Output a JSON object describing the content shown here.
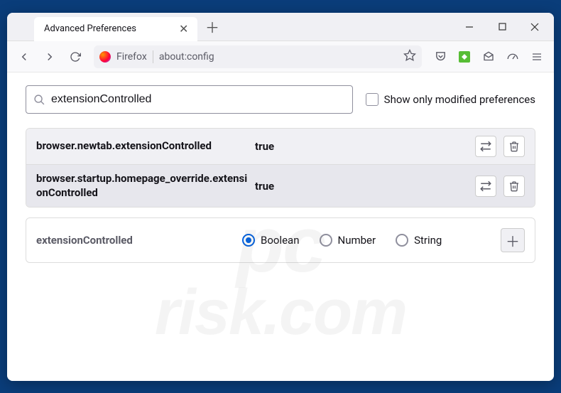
{
  "tab": {
    "title": "Advanced Preferences"
  },
  "urlbar": {
    "identity_label": "Firefox",
    "url": "about:config"
  },
  "search": {
    "value": "extensionControlled"
  },
  "modified_only_label": "Show only modified preferences",
  "prefs": [
    {
      "name": "browser.newtab.extensionControlled",
      "value": "true"
    },
    {
      "name": "browser.startup.homepage_override.extensionControlled",
      "value": "true"
    }
  ],
  "new_pref": {
    "name": "extensionControlled",
    "types": [
      "Boolean",
      "Number",
      "String"
    ],
    "selected": "Boolean"
  },
  "watermark": {
    "line1": "pc",
    "line2": "risk.com"
  }
}
